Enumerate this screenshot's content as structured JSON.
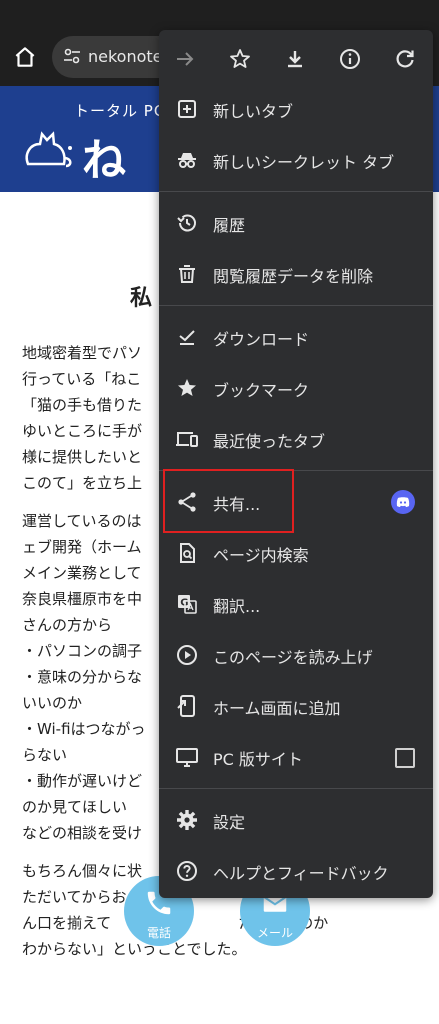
{
  "address_bar": {
    "url": "nekonote."
  },
  "banner": {
    "tagline": "トータル PC",
    "logo": "ね"
  },
  "article": {
    "heading": "私",
    "para1": "地域密着型でパソ\n行っている「ねこ\n「猫の手も借りた\nゆいところに手が\n様に提供したいと\nこのて」を立ち上",
    "para2": "運営しているのは\nェブ開発（ホーム\nメイン業務として\n奈良県橿原市を中\nさんの方から\n・パソコンの調子\n・意味の分からな\nいいのか\n・Wi-fiはつながっ\nらない\n・動作が遅いけど\nのか見てほしい\nなどの相談を受け",
    "para3": "もちろん個々に状\nただいてからお\nん口を揃えて　　「どこ　　　　たらいいのか\nわからない」ということでした。"
  },
  "fab": {
    "tel_label": "電話",
    "mail_label": "メール"
  },
  "menu": {
    "items": [
      {
        "label": "新しいタブ"
      },
      {
        "label": "新しいシークレット タブ"
      },
      {
        "label": "履歴"
      },
      {
        "label": "閲覧履歴データを削除"
      },
      {
        "label": "ダウンロード"
      },
      {
        "label": "ブックマーク"
      },
      {
        "label": "最近使ったタブ"
      },
      {
        "label": "共有..."
      },
      {
        "label": "ページ内検索"
      },
      {
        "label": "翻訳..."
      },
      {
        "label": "このページを読み上げ"
      },
      {
        "label": "ホーム画面に追加"
      },
      {
        "label": "PC 版サイト"
      },
      {
        "label": "設定"
      },
      {
        "label": "ヘルプとフィードバック"
      }
    ]
  },
  "colors": {
    "menu_bg": "#2d2e30",
    "banner": "#1e3f8f",
    "highlight": "#e02020",
    "fab": "#6fc3ea",
    "discord": "#5865f2"
  },
  "icons": [
    "home-icon",
    "tune-icon",
    "forward-icon",
    "star-icon",
    "download-icon",
    "info-icon",
    "refresh-icon"
  ]
}
